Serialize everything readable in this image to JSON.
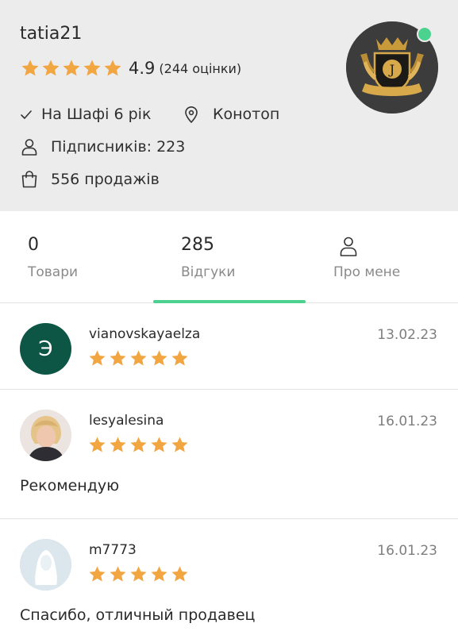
{
  "profile": {
    "username": "tatia21",
    "rating_value": "4.9",
    "rating_count": "(244 оцінки)",
    "stars": 5,
    "on_shafa": "На Шафі 6 рік",
    "city": "Конотоп",
    "followers": "Підписників: 223",
    "sales": "556 продажів",
    "avatar_icon": "gold-crest-logo",
    "online": true
  },
  "tabs": {
    "products": {
      "count": "0",
      "label": "Товари"
    },
    "reviews": {
      "count": "285",
      "label": "Відгуки",
      "active": true
    },
    "about": {
      "label": "Про мене",
      "icon": "person-icon"
    }
  },
  "reviews": [
    {
      "user": "vianovskayaelza",
      "date": "13.02.23",
      "stars": 5,
      "avatar_letter": "Э",
      "text": ""
    },
    {
      "user": "lesyalesina",
      "date": "16.01.23",
      "stars": 5,
      "avatar_type": "photo",
      "text": "Рекомендую"
    },
    {
      "user": "m7773",
      "date": "16.01.23",
      "stars": 5,
      "avatar_type": "placeholder",
      "text": "Спасибо, отличный продавец"
    }
  ],
  "colors": {
    "star": "#f2a641",
    "accent": "#4cd08d",
    "header_bg": "#ececec",
    "letter_avatar_bg": "#0d5544"
  }
}
